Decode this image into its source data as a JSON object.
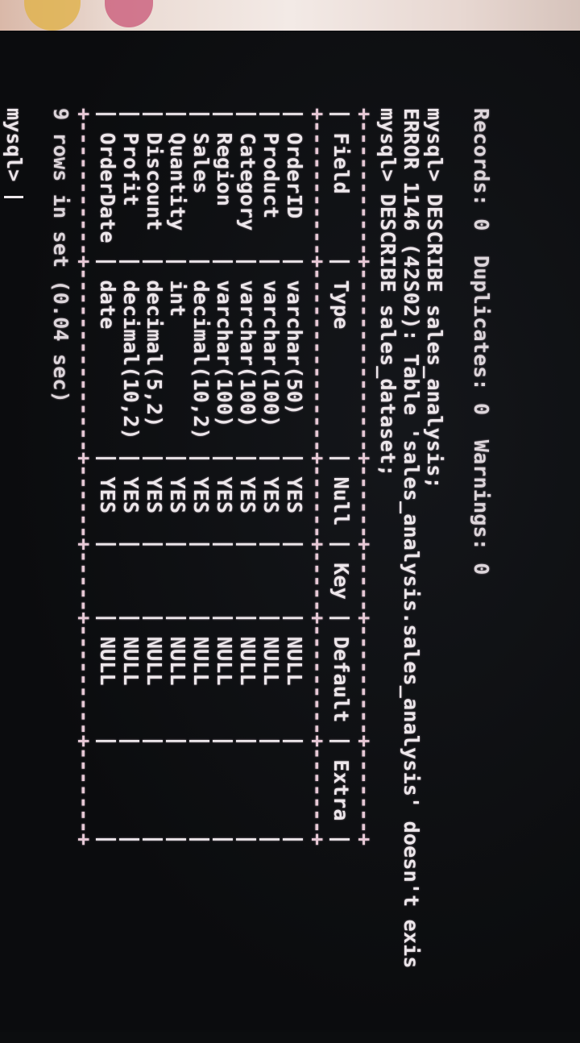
{
  "terminal": {
    "lines": [
      "Records: 0  Duplicates: 0  Warnings: 0",
      "",
      "mysql> DESCRIBE sales_analysis;",
      "ERROR 1146 (42S02): Table 'sales_analysis.sales_analysis' doesn't exis",
      "mysql> DESCRIBE sales_dataset;"
    ],
    "table": {
      "border": "+-----------+---------------+------+-----+---------+-------+",
      "header": "| Field     | Type          | Null | Key | Default | Extra |",
      "rows": [
        "| OrderID   | varchar(50)   | YES  |     | NULL    |       |",
        "| Product   | varchar(100)  | YES  |     | NULL    |       |",
        "| Category  | varchar(100)  | YES  |     | NULL    |       |",
        "| Region    | varchar(100)  | YES  |     | NULL    |       |",
        "| Sales     | decimal(10,2) | YES  |     | NULL    |       |",
        "| Quantity  | int           | YES  |     | NULL    |       |",
        "| Discount  | decimal(5,2)  | YES  |     | NULL    |       |",
        "| Profit    | decimal(10,2) | YES  |     | NULL    |       |",
        "| OrderDate | date          | YES  |     | NULL    |       |"
      ]
    },
    "footer": "9 rows in set (0.04 sec)",
    "prompt": "mysql> "
  }
}
